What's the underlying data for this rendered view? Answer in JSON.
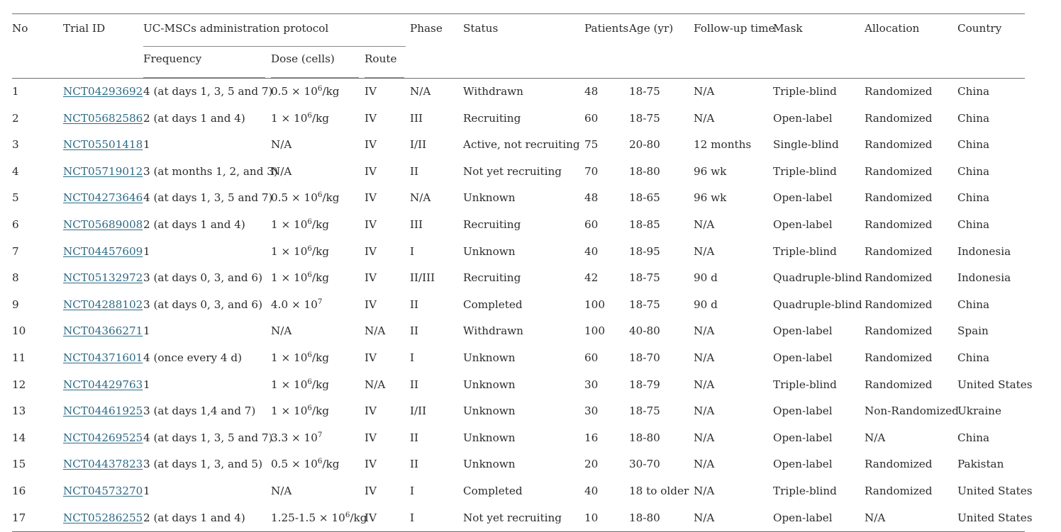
{
  "table": {
    "columns": {
      "no": "No",
      "trial_id": "Trial ID",
      "protocol_group": "UC-MSCs administration protocol",
      "frequency": "Frequency",
      "dose": "Dose (cells)",
      "route": "Route",
      "phase": "Phase",
      "status": "Status",
      "patients": "Patients",
      "age": "Age (yr)",
      "follow_up": "Follow-up time",
      "mask": "Mask",
      "allocation": "Allocation",
      "country": "Country"
    },
    "link_color": "#2b6a86",
    "rule_color": "#6e6e6e",
    "rows": [
      {
        "no": "1",
        "trial_id": "NCT04293692",
        "frequency": "4 (at days 1, 3, 5 and 7)",
        "dose_mantissa": "0.5 × 10",
        "dose_exp": "6",
        "dose_suffix": "/kg",
        "route": "IV",
        "phase": "N/A",
        "status": "Withdrawn",
        "patients": "48",
        "age": "18-75",
        "follow_up": "N/A",
        "mask": "Triple-blind",
        "allocation": "Randomized",
        "country": "China"
      },
      {
        "no": "2",
        "trial_id": "NCT05682586",
        "frequency": "2 (at days 1 and 4)",
        "dose_mantissa": "1 × 10",
        "dose_exp": "6",
        "dose_suffix": "/kg",
        "route": "IV",
        "phase": "III",
        "status": "Recruiting",
        "patients": "60",
        "age": "18-75",
        "follow_up": "N/A",
        "mask": "Open-label",
        "allocation": "Randomized",
        "country": "China"
      },
      {
        "no": "3",
        "trial_id": "NCT05501418",
        "frequency": "1",
        "dose_mantissa": "N/A",
        "dose_exp": "",
        "dose_suffix": "",
        "route": "IV",
        "phase": "I/II",
        "status": "Active, not recruiting",
        "patients": "75",
        "age": "20-80",
        "follow_up": "12 months",
        "mask": "Single-blind",
        "allocation": "Randomized",
        "country": "China"
      },
      {
        "no": "4",
        "trial_id": "NCT05719012",
        "frequency": "3 (at months 1, 2, and 3)",
        "dose_mantissa": "N/A",
        "dose_exp": "",
        "dose_suffix": "",
        "route": "IV",
        "phase": "II",
        "status": "Not yet recruiting",
        "patients": "70",
        "age": "18-80",
        "follow_up": "96 wk",
        "mask": "Triple-blind",
        "allocation": "Randomized",
        "country": "China"
      },
      {
        "no": "5",
        "trial_id": "NCT04273646",
        "frequency": "4 (at days 1, 3, 5 and 7)",
        "dose_mantissa": "0.5 × 10",
        "dose_exp": "6",
        "dose_suffix": "/kg",
        "route": "IV",
        "phase": "N/A",
        "status": "Unknown",
        "patients": "48",
        "age": "18-65",
        "follow_up": "96 wk",
        "mask": "Open-label",
        "allocation": "Randomized",
        "country": "China"
      },
      {
        "no": "6",
        "trial_id": "NCT05689008",
        "frequency": "2 (at days 1 and 4)",
        "dose_mantissa": "1 × 10",
        "dose_exp": "6",
        "dose_suffix": "/kg",
        "route": "IV",
        "phase": "III",
        "status": "Recruiting",
        "patients": "60",
        "age": "18-85",
        "follow_up": "N/A",
        "mask": "Open-label",
        "allocation": "Randomized",
        "country": "China"
      },
      {
        "no": "7",
        "trial_id": "NCT04457609",
        "frequency": "1",
        "dose_mantissa": "1 × 10",
        "dose_exp": "6",
        "dose_suffix": "/kg",
        "route": "IV",
        "phase": "I",
        "status": "Unknown",
        "patients": "40",
        "age": "18-95",
        "follow_up": "N/A",
        "mask": "Triple-blind",
        "allocation": "Randomized",
        "country": "Indonesia"
      },
      {
        "no": "8",
        "trial_id": "NCT05132972",
        "frequency": "3 (at days 0, 3, and 6)",
        "dose_mantissa": "1 × 10",
        "dose_exp": "6",
        "dose_suffix": "/kg",
        "route": "IV",
        "phase": "II/III",
        "status": "Recruiting",
        "patients": "42",
        "age": "18-75",
        "follow_up": "90 d",
        "mask": "Quadruple-blind",
        "allocation": "Randomized",
        "country": "Indonesia"
      },
      {
        "no": "9",
        "trial_id": "NCT04288102",
        "frequency": "3 (at days 0, 3, and 6)",
        "dose_mantissa": "4.0 × 10",
        "dose_exp": "7",
        "dose_suffix": "",
        "route": "IV",
        "phase": "II",
        "status": "Completed",
        "patients": "100",
        "age": "18-75",
        "follow_up": "90 d",
        "mask": "Quadruple-blind",
        "allocation": "Randomized",
        "country": "China"
      },
      {
        "no": "10",
        "trial_id": "NCT04366271",
        "frequency": "1",
        "dose_mantissa": "N/A",
        "dose_exp": "",
        "dose_suffix": "",
        "route": "N/A",
        "phase": "II",
        "status": "Withdrawn",
        "patients": "100",
        "age": "40-80",
        "follow_up": "N/A",
        "mask": "Open-label",
        "allocation": "Randomized",
        "country": "Spain"
      },
      {
        "no": "11",
        "trial_id": "NCT04371601",
        "frequency": "4 (once every 4 d)",
        "dose_mantissa": "1 × 10",
        "dose_exp": "6",
        "dose_suffix": "/kg",
        "route": "IV",
        "phase": "I",
        "status": "Unknown",
        "patients": "60",
        "age": "18-70",
        "follow_up": "N/A",
        "mask": "Open-label",
        "allocation": "Randomized",
        "country": "China"
      },
      {
        "no": "12",
        "trial_id": "NCT04429763",
        "frequency": "1",
        "dose_mantissa": "1 × 10",
        "dose_exp": "6",
        "dose_suffix": "/kg",
        "route": "N/A",
        "phase": "II",
        "status": "Unknown",
        "patients": "30",
        "age": "18-79",
        "follow_up": "N/A",
        "mask": "Triple-blind",
        "allocation": "Randomized",
        "country": "United States"
      },
      {
        "no": "13",
        "trial_id": "NCT04461925",
        "frequency": "3 (at days 1,4 and 7)",
        "dose_mantissa": "1 × 10",
        "dose_exp": "6",
        "dose_suffix": "/kg",
        "route": "IV",
        "phase": "I/II",
        "status": "Unknown",
        "patients": "30",
        "age": "18-75",
        "follow_up": "N/A",
        "mask": "Open-label",
        "allocation": "Non-Randomized",
        "country": "Ukraine"
      },
      {
        "no": "14",
        "trial_id": "NCT04269525",
        "frequency": "4 (at days 1, 3, 5 and 7)",
        "dose_mantissa": "3.3 × 10",
        "dose_exp": "7",
        "dose_suffix": "",
        "route": "IV",
        "phase": "II",
        "status": "Unknown",
        "patients": "16",
        "age": "18-80",
        "follow_up": "N/A",
        "mask": "Open-label",
        "allocation": "N/A",
        "country": "China"
      },
      {
        "no": "15",
        "trial_id": "NCT04437823",
        "frequency": "3 (at days 1, 3, and 5)",
        "dose_mantissa": "0.5 × 10",
        "dose_exp": "6",
        "dose_suffix": "/kg",
        "route": "IV",
        "phase": "II",
        "status": "Unknown",
        "patients": "20",
        "age": "30-70",
        "follow_up": "N/A",
        "mask": "Open-label",
        "allocation": "Randomized",
        "country": "Pakistan"
      },
      {
        "no": "16",
        "trial_id": "NCT04573270",
        "frequency": "1",
        "dose_mantissa": "N/A",
        "dose_exp": "",
        "dose_suffix": "",
        "route": "IV",
        "phase": "I",
        "status": "Completed",
        "patients": "40",
        "age": "18 to older",
        "follow_up": "N/A",
        "mask": "Triple-blind",
        "allocation": "Randomized",
        "country": "United States"
      },
      {
        "no": "17",
        "trial_id": "NCT05286255",
        "frequency": "2 (at days 1 and 4)",
        "dose_mantissa": "1.25-1.5 × 10",
        "dose_exp": "6",
        "dose_suffix": "/kg",
        "route": "IV",
        "phase": "I",
        "status": "Not yet recruiting",
        "patients": "10",
        "age": "18-80",
        "follow_up": "N/A",
        "mask": "Open-label",
        "allocation": "N/A",
        "country": "United States"
      }
    ]
  }
}
